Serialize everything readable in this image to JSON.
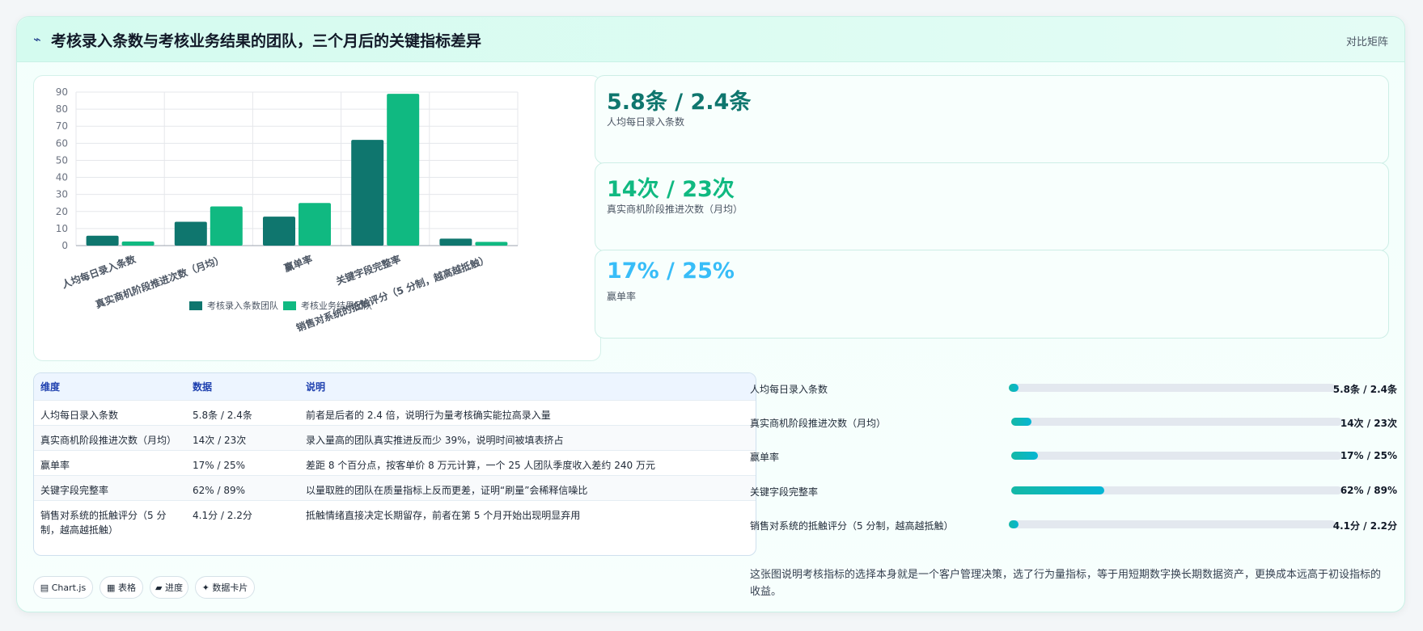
{
  "header": {
    "icon": "⌁",
    "title": "考核录入条数与考核业务结果的团队，三个月后的关键指标差异",
    "right_label": "对比矩阵"
  },
  "colors": {
    "series_a": "#0f766e",
    "series_b": "#10b981"
  },
  "chart_data": {
    "type": "bar",
    "categories": [
      "人均每日录入条数",
      "真实商机阶段推进次数（月均）",
      "赢单率",
      "关键字段完整率",
      "销售对系统的抵触评分（5 分制，越高越抵触）"
    ],
    "series": [
      {
        "name": "考核录入条数团队",
        "values": [
          5.8,
          14,
          17,
          62,
          4.1
        ]
      },
      {
        "name": "考核业务结果团队",
        "values": [
          2.4,
          23,
          25,
          89,
          2.2
        ]
      }
    ],
    "yticks": [
      "0",
      "10",
      "20",
      "30",
      "40",
      "50",
      "60",
      "70",
      "80",
      "90"
    ],
    "ylim": [
      0,
      90
    ],
    "grid": true,
    "legend": "bottom"
  },
  "stats": [
    {
      "value": "5.8条 / 2.4条",
      "label": "人均每日录入条数",
      "color": "#0f766e"
    },
    {
      "value": "14次 / 23次",
      "label": "真实商机阶段推进次数（月均）",
      "color": "#10b981"
    },
    {
      "value": "17% / 25%",
      "label": "赢单率",
      "color": "#38bdf8"
    }
  ],
  "table": {
    "headers": [
      "维度",
      "数据",
      "说明"
    ],
    "rows": [
      [
        "人均每日录入条数",
        "5.8条 / 2.4条",
        "前者是后者的 2.4 倍，说明行为量考核确实能拉高录入量"
      ],
      [
        "真实商机阶段推进次数（月均）",
        "14次 / 23次",
        "录入量高的团队真实推进反而少 39%，说明时间被填表挤占"
      ],
      [
        "赢单率",
        "17% / 25%",
        "差距 8 个百分点，按客单价 8 万元计算，一个 25 人团队季度收入差约 240 万元"
      ],
      [
        "关键字段完整率",
        "62% / 89%",
        "以量取胜的团队在质量指标上反而更差，证明“刷量”会稀释信噪比"
      ],
      [
        "销售对系统的抵触评分（5 分制，越高越抵触）",
        "4.1分 / 2.2分",
        "抵触情绪直接决定长期留存，前者在第 5 个月开始出现明显弃用"
      ]
    ]
  },
  "progress": [
    {
      "label": "人均每日录入条数",
      "value": "5.8条 / 2.4条",
      "fraction": 0.03
    },
    {
      "label": "真实商机阶段推进次数（月均）",
      "value": "14次 / 23次",
      "fraction": 0.06
    },
    {
      "label": "赢单率",
      "value": "17% / 25%",
      "fraction": 0.08
    },
    {
      "label": "关键字段完整率",
      "value": "62% / 89%",
      "fraction": 0.28
    },
    {
      "label": "销售对系统的抵触评分（5 分制，越高越抵触）",
      "value": "4.1分 / 2.2分",
      "fraction": 0.03
    }
  ],
  "pills": [
    {
      "icon": "▤",
      "label": "Chart.js"
    },
    {
      "icon": "▦",
      "label": "表格"
    },
    {
      "icon": "▰",
      "label": "进度"
    },
    {
      "icon": "✦",
      "label": "数据卡片"
    }
  ],
  "summary": "这张图说明考核指标的选择本身就是一个客户管理决策，选了行为量指标，等于用短期数字换长期数据资产，更换成本远高于初设指标的收益。"
}
